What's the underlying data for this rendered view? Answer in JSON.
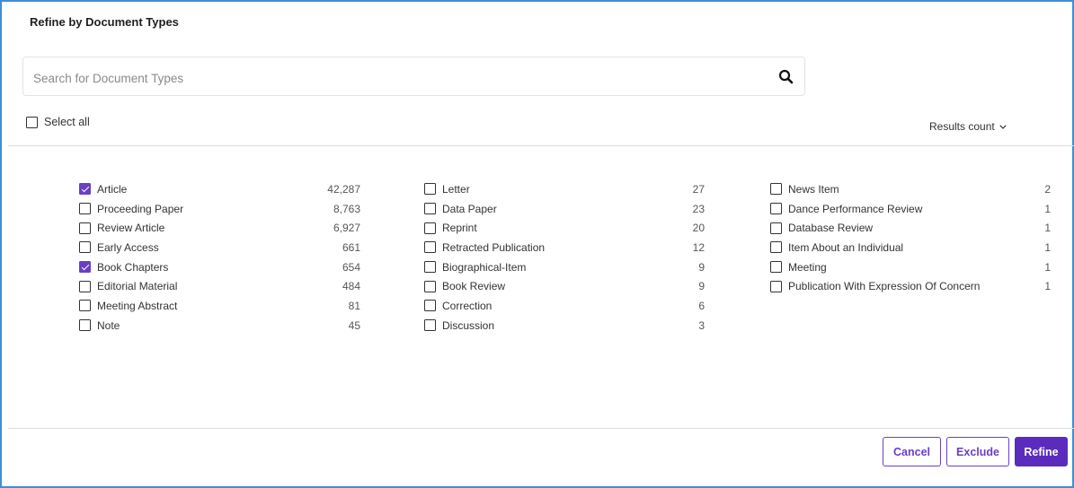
{
  "dialog": {
    "title": "Refine by Document Types"
  },
  "search": {
    "placeholder": "Search for Document Types",
    "value": "",
    "icon": "search-icon"
  },
  "select_all": {
    "label": "Select all",
    "checked": false
  },
  "sort": {
    "label": "Results count",
    "icon": "chevron-down-icon"
  },
  "columns": [
    {
      "items": [
        {
          "label": "Article",
          "count": "42,287",
          "checked": true
        },
        {
          "label": "Proceeding Paper",
          "count": "8,763",
          "checked": false
        },
        {
          "label": "Review Article",
          "count": "6,927",
          "checked": false
        },
        {
          "label": "Early Access",
          "count": "661",
          "checked": false
        },
        {
          "label": "Book Chapters",
          "count": "654",
          "checked": true
        },
        {
          "label": "Editorial Material",
          "count": "484",
          "checked": false
        },
        {
          "label": "Meeting Abstract",
          "count": "81",
          "checked": false
        },
        {
          "label": "Note",
          "count": "45",
          "checked": false
        }
      ]
    },
    {
      "items": [
        {
          "label": "Letter",
          "count": "27",
          "checked": false
        },
        {
          "label": "Data Paper",
          "count": "23",
          "checked": false
        },
        {
          "label": "Reprint",
          "count": "20",
          "checked": false
        },
        {
          "label": "Retracted Publication",
          "count": "12",
          "checked": false
        },
        {
          "label": "Biographical-Item",
          "count": "9",
          "checked": false
        },
        {
          "label": "Book Review",
          "count": "9",
          "checked": false
        },
        {
          "label": "Correction",
          "count": "6",
          "checked": false
        },
        {
          "label": "Discussion",
          "count": "3",
          "checked": false
        }
      ]
    },
    {
      "items": [
        {
          "label": "News Item",
          "count": "2",
          "checked": false
        },
        {
          "label": "Dance Performance Review",
          "count": "1",
          "checked": false
        },
        {
          "label": "Database Review",
          "count": "1",
          "checked": false
        },
        {
          "label": "Item About an Individual",
          "count": "1",
          "checked": false
        },
        {
          "label": "Meeting",
          "count": "1",
          "checked": false
        },
        {
          "label": "Publication With Expression Of Concern",
          "count": "1",
          "checked": false
        }
      ]
    }
  ],
  "actions": {
    "cancel": "Cancel",
    "exclude": "Exclude",
    "refine": "Refine"
  },
  "colors": {
    "accent": "#6b3fc5",
    "primary_button": "#5a2bbd",
    "frame_border": "#3d8fd6"
  }
}
